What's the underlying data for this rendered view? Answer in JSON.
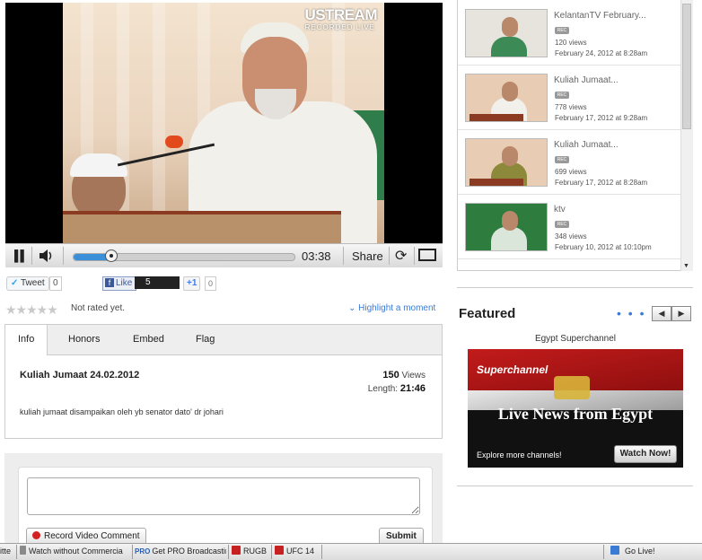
{
  "player": {
    "watermark": "USTREAM",
    "watermark_sub": "RECORDED LIVE",
    "time": "03:38",
    "share_label": "Share",
    "progress_fraction": 0.17
  },
  "social": {
    "tweet_label": "Tweet",
    "tweet_count": "0",
    "like_label": "Like",
    "like_count": "5",
    "gplus_label": "+1",
    "gplus_count": "0"
  },
  "rating": {
    "status": "Not rated yet.",
    "highlight_label": "Highlight a moment"
  },
  "tabs": [
    {
      "label": "Info"
    },
    {
      "label": "Honors"
    },
    {
      "label": "Embed"
    },
    {
      "label": "Flag"
    }
  ],
  "info": {
    "title": "Kuliah Jumaat 24.02.2012",
    "views_value": "150",
    "views_label": "Views",
    "length_label": "Length:",
    "length_value": "21:46",
    "description": "kuliah jumaat disampaikan oleh yb senator dato' dr johari"
  },
  "comment": {
    "placeholder": "",
    "record_label": "Record Video Comment",
    "submit_label": "Submit"
  },
  "related": [
    {
      "title": "KelantanTV February...",
      "badge": "REC",
      "views": "120 views",
      "date": "February 24, 2012 at 8:28am"
    },
    {
      "title": "Kuliah Jumaat...",
      "badge": "REC",
      "views": "778 views",
      "date": "February 17, 2012 at 9:28am"
    },
    {
      "title": "Kuliah Jumaat...",
      "badge": "REC",
      "views": "699 views",
      "date": "February 17, 2012 at 8:28am"
    },
    {
      "title": "ktv",
      "badge": "REC",
      "views": "348 views",
      "date": "February 10, 2012 at 10:10pm"
    }
  ],
  "featured": {
    "heading": "Featured",
    "dots": "• • •",
    "prev_label": "◀",
    "next_label": "▶",
    "channel_name": "Egypt Superchannel",
    "banner_logo": "Superchannel",
    "banner_text": "Live News from Egypt",
    "explore_text": "Explore more channels!",
    "watch_label": "Watch Now!"
  },
  "taskbar": {
    "items": [
      {
        "label": "itte"
      },
      {
        "label": "Watch without Commercia"
      },
      {
        "label": "Get PRO Broadcastir"
      },
      {
        "label": "RUGB"
      },
      {
        "label": "UFC 14"
      },
      {
        "label": "Go Live!"
      }
    ],
    "pro_badge": "PRO"
  },
  "colors": {
    "accent": "#3a7bd5",
    "record_red": "#d32020",
    "progress_blue": "#3a8fd8"
  }
}
